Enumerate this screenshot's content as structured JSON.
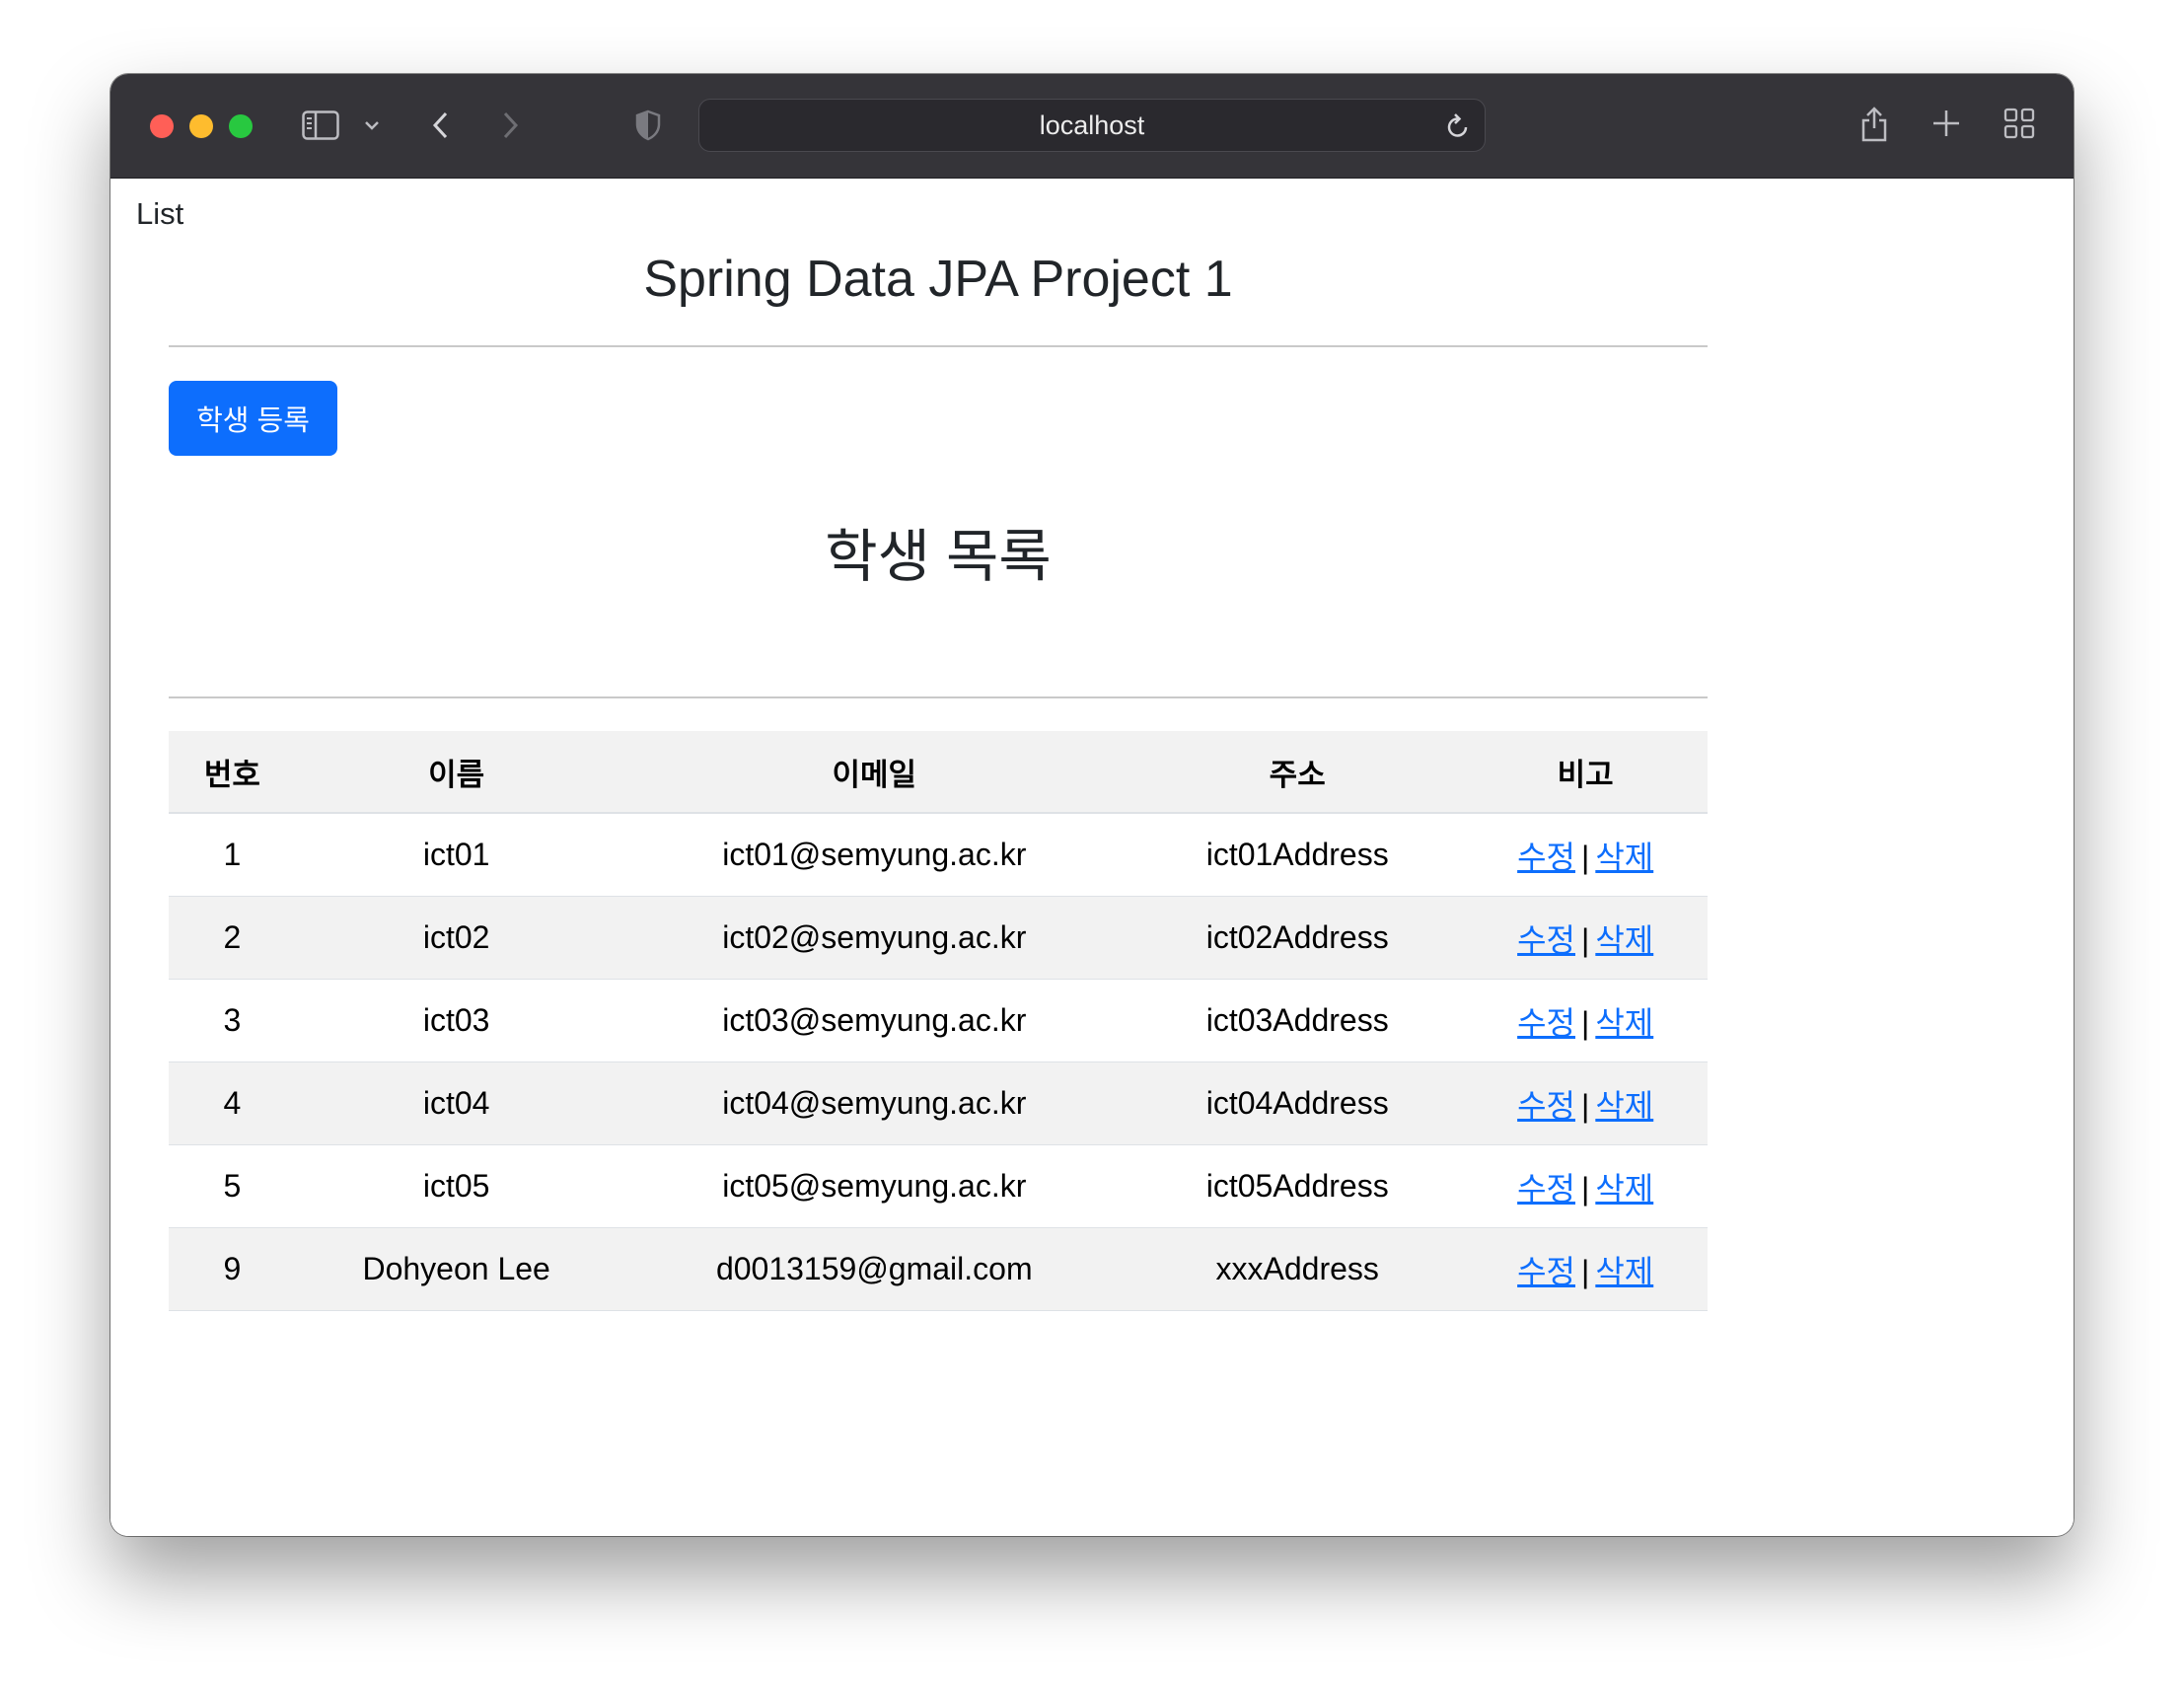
{
  "browser": {
    "url": "localhost"
  },
  "page": {
    "doc_title": "List",
    "heading": "Spring Data JPA Project 1",
    "register_button": "학생 등록",
    "list_heading": "학생 목록"
  },
  "table": {
    "headers": [
      "번호",
      "이름",
      "이메일",
      "주소",
      "비고"
    ],
    "edit_label": "수정",
    "delete_label": "삭제",
    "separator": "|",
    "rows": [
      {
        "no": "1",
        "name": "ict01",
        "email": "ict01@semyung.ac.kr",
        "address": "ict01Address"
      },
      {
        "no": "2",
        "name": "ict02",
        "email": "ict02@semyung.ac.kr",
        "address": "ict02Address"
      },
      {
        "no": "3",
        "name": "ict03",
        "email": "ict03@semyung.ac.kr",
        "address": "ict03Address"
      },
      {
        "no": "4",
        "name": "ict04",
        "email": "ict04@semyung.ac.kr",
        "address": "ict04Address"
      },
      {
        "no": "5",
        "name": "ict05",
        "email": "ict05@semyung.ac.kr",
        "address": "ict05Address"
      },
      {
        "no": "9",
        "name": "Dohyeon Lee",
        "email": "d0013159@gmail.com",
        "address": "xxxAddress"
      }
    ]
  },
  "colors": {
    "accent": "#0d6efd",
    "titlebar": "#353439",
    "close": "#ff5f57",
    "minimize": "#febc2e",
    "zoom": "#28c840"
  },
  "icons": {
    "sidebar": "sidebar-icon",
    "chevron": "chevron-down-icon",
    "back": "back-icon",
    "forward": "forward-icon",
    "privacy": "shield-icon",
    "reload": "reload-icon",
    "share": "share-icon",
    "new_tab": "plus-icon",
    "tabs": "tab-overview-icon"
  }
}
